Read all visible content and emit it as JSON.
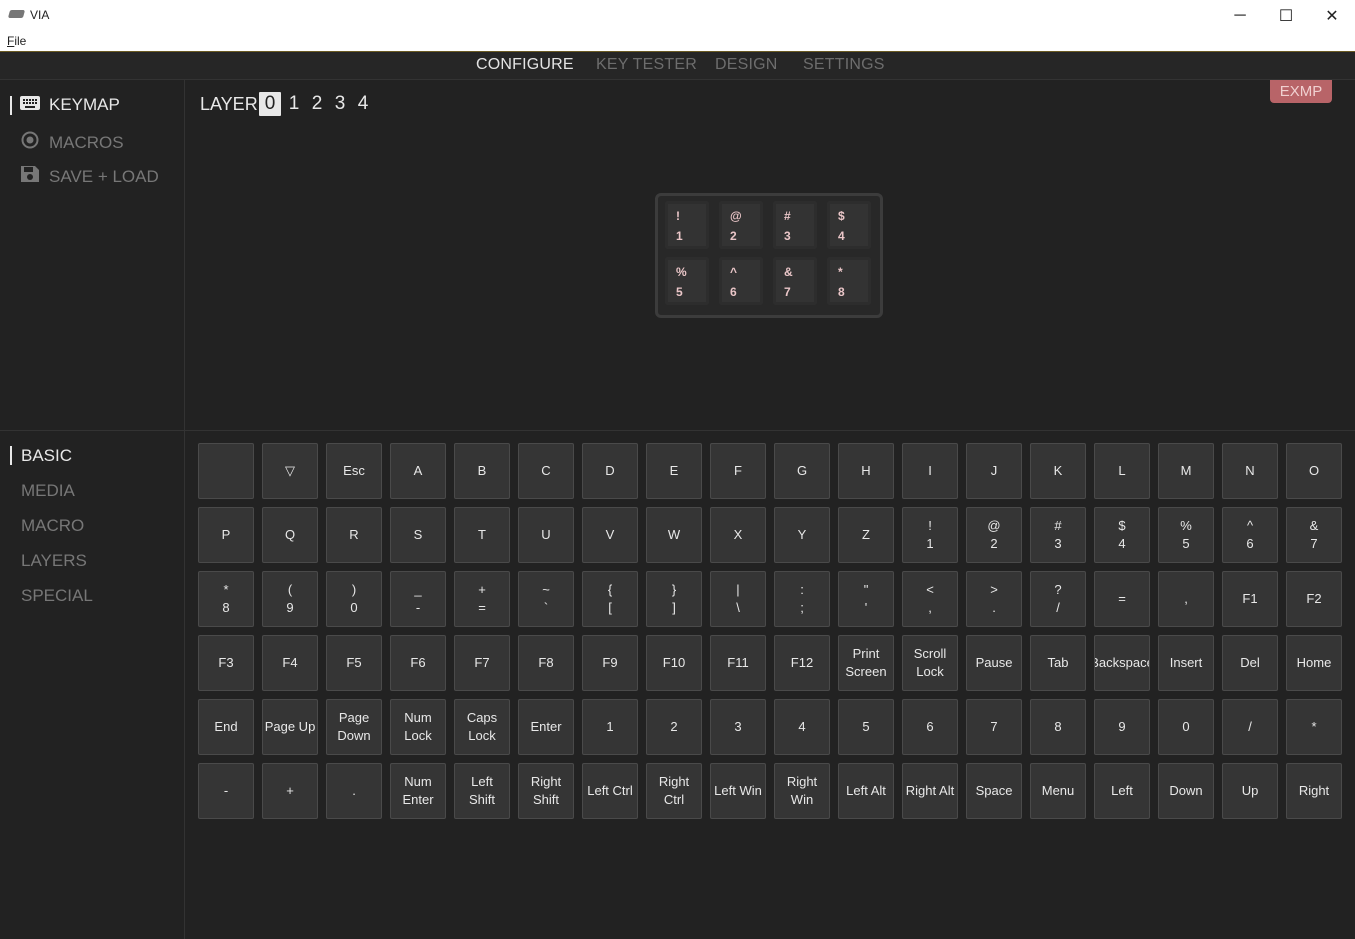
{
  "window": {
    "title": "VIA",
    "min_glyph": "─",
    "max_glyph": "☐",
    "close_glyph": "✕"
  },
  "menu": {
    "file_u": "F",
    "file_rest": "ile"
  },
  "tabs": [
    "CONFIGURE",
    "KEY TESTER",
    "DESIGN",
    "SETTINGS"
  ],
  "nav_top": [
    "KEYMAP",
    "MACROS",
    "SAVE + LOAD"
  ],
  "nav_bottom": [
    "BASIC",
    "MEDIA",
    "MACRO",
    "LAYERS",
    "SPECIAL"
  ],
  "layer": {
    "label": "LAYER",
    "numbers": [
      "0",
      "1",
      "2",
      "3",
      "4"
    ],
    "selected": "0"
  },
  "badge": "EXMP",
  "keyboard_keys": [
    [
      "!",
      "1"
    ],
    [
      "@",
      "2"
    ],
    [
      "#",
      "3"
    ],
    [
      "$",
      "4"
    ],
    [
      "%",
      "5"
    ],
    [
      "^",
      "6"
    ],
    [
      "&",
      "7"
    ],
    [
      "*",
      "8"
    ]
  ],
  "basic_keys": [
    [
      [
        ""
      ],
      [
        "▽"
      ],
      [
        "Esc"
      ],
      [
        "A"
      ],
      [
        "B"
      ],
      [
        "C"
      ],
      [
        "D"
      ],
      [
        "E"
      ],
      [
        "F"
      ],
      [
        "G"
      ],
      [
        "H"
      ],
      [
        "I"
      ],
      [
        "J"
      ],
      [
        "K"
      ],
      [
        "L"
      ],
      [
        "M"
      ],
      [
        "N"
      ],
      [
        "O"
      ]
    ],
    [
      [
        "P"
      ],
      [
        "Q"
      ],
      [
        "R"
      ],
      [
        "S"
      ],
      [
        "T"
      ],
      [
        "U"
      ],
      [
        "V"
      ],
      [
        "W"
      ],
      [
        "X"
      ],
      [
        "Y"
      ],
      [
        "Z"
      ],
      [
        "!",
        "1"
      ],
      [
        "@",
        "2"
      ],
      [
        "#",
        "3"
      ],
      [
        "$",
        "4"
      ],
      [
        "%",
        "5"
      ],
      [
        "^",
        "6"
      ],
      [
        "&",
        "7"
      ]
    ],
    [
      [
        "*",
        "8"
      ],
      [
        "(",
        "9"
      ],
      [
        ")",
        "0"
      ],
      [
        "_",
        "-"
      ],
      [
        "+",
        "="
      ],
      [
        "~",
        "`"
      ],
      [
        "{",
        "["
      ],
      [
        "}",
        "]"
      ],
      [
        "|",
        "\\"
      ],
      [
        ":",
        ";"
      ],
      [
        "\"",
        "'"
      ],
      [
        "<",
        ","
      ],
      [
        ">",
        "."
      ],
      [
        "?",
        "/"
      ],
      [
        "="
      ],
      [
        ","
      ],
      [
        "F1"
      ],
      [
        "F2"
      ]
    ],
    [
      [
        "F3"
      ],
      [
        "F4"
      ],
      [
        "F5"
      ],
      [
        "F6"
      ],
      [
        "F7"
      ],
      [
        "F8"
      ],
      [
        "F9"
      ],
      [
        "F10"
      ],
      [
        "F11"
      ],
      [
        "F12"
      ],
      [
        "Print",
        "Screen"
      ],
      [
        "Scroll",
        "Lock"
      ],
      [
        "Pause"
      ],
      [
        "Tab"
      ],
      [
        "Backspace"
      ],
      [
        "Insert"
      ],
      [
        "Del"
      ],
      [
        "Home"
      ]
    ],
    [
      [
        "End"
      ],
      [
        "Page Up"
      ],
      [
        "Page",
        "Down"
      ],
      [
        "Num",
        "Lock"
      ],
      [
        "Caps",
        "Lock"
      ],
      [
        "Enter"
      ],
      [
        "1"
      ],
      [
        "2"
      ],
      [
        "3"
      ],
      [
        "4"
      ],
      [
        "5"
      ],
      [
        "6"
      ],
      [
        "7"
      ],
      [
        "8"
      ],
      [
        "9"
      ],
      [
        "0"
      ],
      [
        "/"
      ],
      [
        "*"
      ]
    ],
    [
      [
        "-"
      ],
      [
        "+"
      ],
      [
        "."
      ],
      [
        "Num",
        "Enter"
      ],
      [
        "Left",
        "Shift"
      ],
      [
        "Right",
        "Shift"
      ],
      [
        "Left Ctrl"
      ],
      [
        "Right",
        "Ctrl"
      ],
      [
        "Left Win"
      ],
      [
        "Right",
        "Win"
      ],
      [
        "Left Alt"
      ],
      [
        "Right Alt"
      ],
      [
        "Space"
      ],
      [
        "Menu"
      ],
      [
        "Left"
      ],
      [
        "Down"
      ],
      [
        "Up"
      ],
      [
        "Right"
      ]
    ]
  ]
}
